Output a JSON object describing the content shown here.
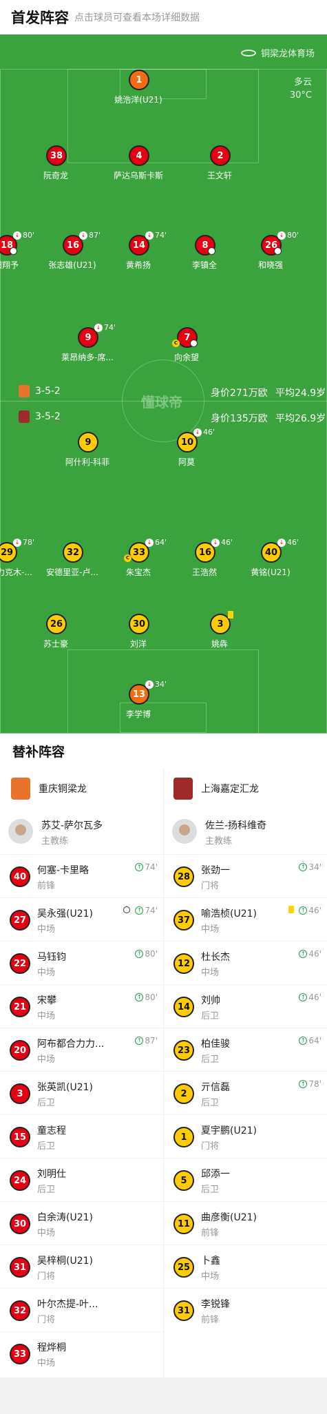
{
  "header": {
    "title": "首发阵容",
    "subtitle": "点击球员可查看本场详细数据"
  },
  "pitch": {
    "venue": "铜梁龙体育场",
    "weather": "多云",
    "temperature": "30°C",
    "brand": "懂球帝",
    "home_bar": {
      "formation": "3-5-2",
      "value": "身价271万欧",
      "avg_age": "平均24.9岁",
      "logo_color": "#e8732a"
    },
    "away_bar": {
      "formation": "3-5-2",
      "value": "身价135万欧",
      "avg_age": "平均26.9岁",
      "logo_color": "#9e2a2a"
    }
  },
  "home_players": [
    {
      "num": "1",
      "name": "姚浩洋(U21)",
      "gk": true
    },
    {
      "num": "38",
      "name": "阮奇龙"
    },
    {
      "num": "4",
      "name": "萨达乌斯卡斯"
    },
    {
      "num": "2",
      "name": "王文轩"
    },
    {
      "num": "18",
      "name": "田翔予",
      "sub": "80'",
      "ball": true
    },
    {
      "num": "16",
      "name": "张志雄(U21)",
      "sub": "87'"
    },
    {
      "num": "14",
      "name": "黄希扬",
      "sub": "74'"
    },
    {
      "num": "8",
      "name": "李镇全",
      "ball": true
    },
    {
      "num": "26",
      "name": "和晓强",
      "sub": "80'",
      "ball": true
    },
    {
      "num": "9",
      "name": "莱昂纳多-席...",
      "sub": "74'"
    },
    {
      "num": "7",
      "name": "向余望",
      "captain": true,
      "ball": true
    }
  ],
  "away_players": [
    {
      "num": "9",
      "name": "阿什利-科菲"
    },
    {
      "num": "10",
      "name": "阿莫",
      "sub": "46'"
    },
    {
      "num": "29",
      "name": "阿布力克木-...",
      "sub": "78'"
    },
    {
      "num": "32",
      "name": "安德里亚-卢..."
    },
    {
      "num": "33",
      "name": "朱宝杰",
      "sub": "64'",
      "captain": true
    },
    {
      "num": "16",
      "name": "王浩然",
      "sub": "46'"
    },
    {
      "num": "40",
      "name": "黄铭(U21)",
      "sub": "46'"
    },
    {
      "num": "26",
      "name": "苏士豪"
    },
    {
      "num": "30",
      "name": "刘洋"
    },
    {
      "num": "3",
      "name": "姚犇",
      "yellow": true
    },
    {
      "num": "13",
      "name": "李学博",
      "sub": "34'",
      "gk": true
    }
  ],
  "subs": {
    "title": "替补阵容",
    "home_team": {
      "name": "重庆铜梁龙",
      "logo_color": "#e8732a"
    },
    "away_team": {
      "name": "上海嘉定汇龙",
      "logo_color": "#9e2a2a"
    },
    "home_coach": {
      "name": "苏艾-萨尔瓦多",
      "role": "主教练"
    },
    "away_coach": {
      "name": "佐兰-扬科维奇",
      "role": "主教练"
    },
    "home": [
      {
        "num": "40",
        "name": "何塞-卡里略",
        "pos": "前锋",
        "time": "74'"
      },
      {
        "num": "27",
        "name": "吴永强(U21)",
        "pos": "中场",
        "time": "74'",
        "event": "ball"
      },
      {
        "num": "22",
        "name": "马钰钧",
        "pos": "中场",
        "time": "80'"
      },
      {
        "num": "21",
        "name": "宋攀",
        "pos": "中场",
        "time": "80'"
      },
      {
        "num": "20",
        "name": "阿布都合力力...",
        "pos": "中场",
        "time": "87'"
      },
      {
        "num": "3",
        "name": "张英凯(U21)",
        "pos": "后卫"
      },
      {
        "num": "15",
        "name": "童志程",
        "pos": "后卫"
      },
      {
        "num": "24",
        "name": "刘明仕",
        "pos": "后卫"
      },
      {
        "num": "30",
        "name": "白余涛(U21)",
        "pos": "中场"
      },
      {
        "num": "31",
        "name": "吴梓桐(U21)",
        "pos": "门将"
      },
      {
        "num": "32",
        "name": "叶尔杰提-叶...",
        "pos": "门将"
      },
      {
        "num": "33",
        "name": "程烨桐",
        "pos": "中场"
      }
    ],
    "away": [
      {
        "num": "28",
        "name": "张劲一",
        "pos": "门将",
        "time": "34'"
      },
      {
        "num": "37",
        "name": "喻浩桢(U21)",
        "pos": "中场",
        "time": "46'",
        "event": "yellow"
      },
      {
        "num": "12",
        "name": "杜长杰",
        "pos": "中场",
        "time": "46'"
      },
      {
        "num": "14",
        "name": "刘帅",
        "pos": "后卫",
        "time": "46'"
      },
      {
        "num": "23",
        "name": "柏佳骏",
        "pos": "后卫",
        "time": "64'"
      },
      {
        "num": "2",
        "name": "亓信磊",
        "pos": "后卫",
        "time": "78'"
      },
      {
        "num": "1",
        "name": "夏宇鹏(U21)",
        "pos": "门将"
      },
      {
        "num": "5",
        "name": "邱添一",
        "pos": "后卫"
      },
      {
        "num": "11",
        "name": "曲彦衡(U21)",
        "pos": "前锋"
      },
      {
        "num": "25",
        "name": "卜鑫",
        "pos": "中场"
      },
      {
        "num": "31",
        "name": "李锐锋",
        "pos": "前锋"
      }
    ]
  }
}
